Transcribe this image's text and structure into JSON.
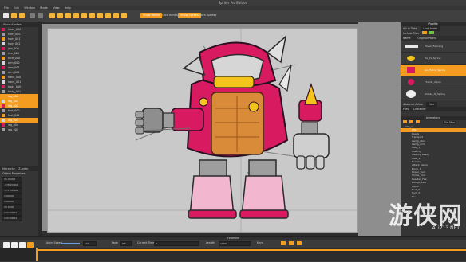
{
  "app": {
    "title": "Spriter Pro Edition"
  },
  "menu": [
    "File",
    "Edit",
    "Window",
    "Mode",
    "View",
    "Help"
  ],
  "toolbar": {
    "bones_btn": "Show Bones",
    "lock_bones": "Lock Bones",
    "show_sprites": "Show Sprites",
    "lock_sprites": "Lock Sprites"
  },
  "left_panel": {
    "header": "Show Sprites",
    "tree": [
      "head_000",
      "horn_000",
      "horn_001",
      "horn_002",
      "jaw_000",
      "eye_000",
      "face_000",
      "arm_000",
      "arm_001",
      "arm_002",
      "hand_000",
      "hand_001",
      "body_000",
      "body_001",
      "leg_000",
      "leg_001",
      "leg_002",
      "foot_000",
      "foot_001",
      "leg_003",
      "leg_004",
      "leg_005"
    ],
    "selected_rows": [
      "leg_000",
      "leg_001",
      "leg_002",
      "leg_003"
    ],
    "tabs": [
      "Hierarchy",
      "Z-order"
    ],
    "props_title": "Object Properties",
    "props": [
      "96.00000",
      "-378.20000",
      "-271.30000",
      "1.00000",
      "1.00000",
      "23.0000",
      "100.00000",
      "100.00000"
    ],
    "prop_labels": [
      "x",
      "y",
      "angle",
      "scale",
      "alpha"
    ]
  },
  "right_panel": {
    "title": "Palette",
    "file_label": "Art in Data",
    "file_value": "Load folder",
    "search_label": "Include Files",
    "list_headers": [
      "Name",
      "Original Parent"
    ],
    "items": [
      "Power_Fwd.png",
      "fire_fx_Spring",
      "pre_flame_Spring",
      "Thumb_2.png",
      "Smoke_fx_Spring"
    ],
    "selected_item": "pre_flame_Spring",
    "assigned_label": "Assigned Action",
    "assigned_value": "Idle",
    "tabs": [
      "Files",
      "Character"
    ],
    "anim_title": "Animations",
    "anim_buttons": [
      "New",
      "Duplicate",
      "Delete",
      "Set Max"
    ],
    "anim_folder": "Idle_1",
    "animations": [
      "Idle",
      "Ready",
      "Transport",
      "swing_start",
      "swing_mid",
      "Walk_1",
      "Walking",
      "Walking Ready",
      "Walk_2",
      "Running",
      "Attack_swing",
      "Block_1",
      "Power_Fwd",
      "Throw_Fwd",
      "Readies_Fire",
      "Dodge_Bwd",
      "Death",
      "Hurt_2",
      "Hurt_3",
      "Die"
    ],
    "selected_animation": "Idle"
  },
  "timeline": {
    "title": "Timeline",
    "speed_label": "Anim Speed",
    "speed_value": "100",
    "fade_label": "Fade",
    "fade_value": "Off",
    "time_label": "Current Time",
    "time_value": "0",
    "length_label": "Length",
    "length_value": "1000",
    "keys_label": "Keys"
  },
  "watermark": {
    "text": "游侠网",
    "url": "ALi213.NET"
  },
  "colors": {
    "accent": "#f39c1f",
    "robot_pink": "#d81b60",
    "canvas": "#c9c9c9"
  }
}
